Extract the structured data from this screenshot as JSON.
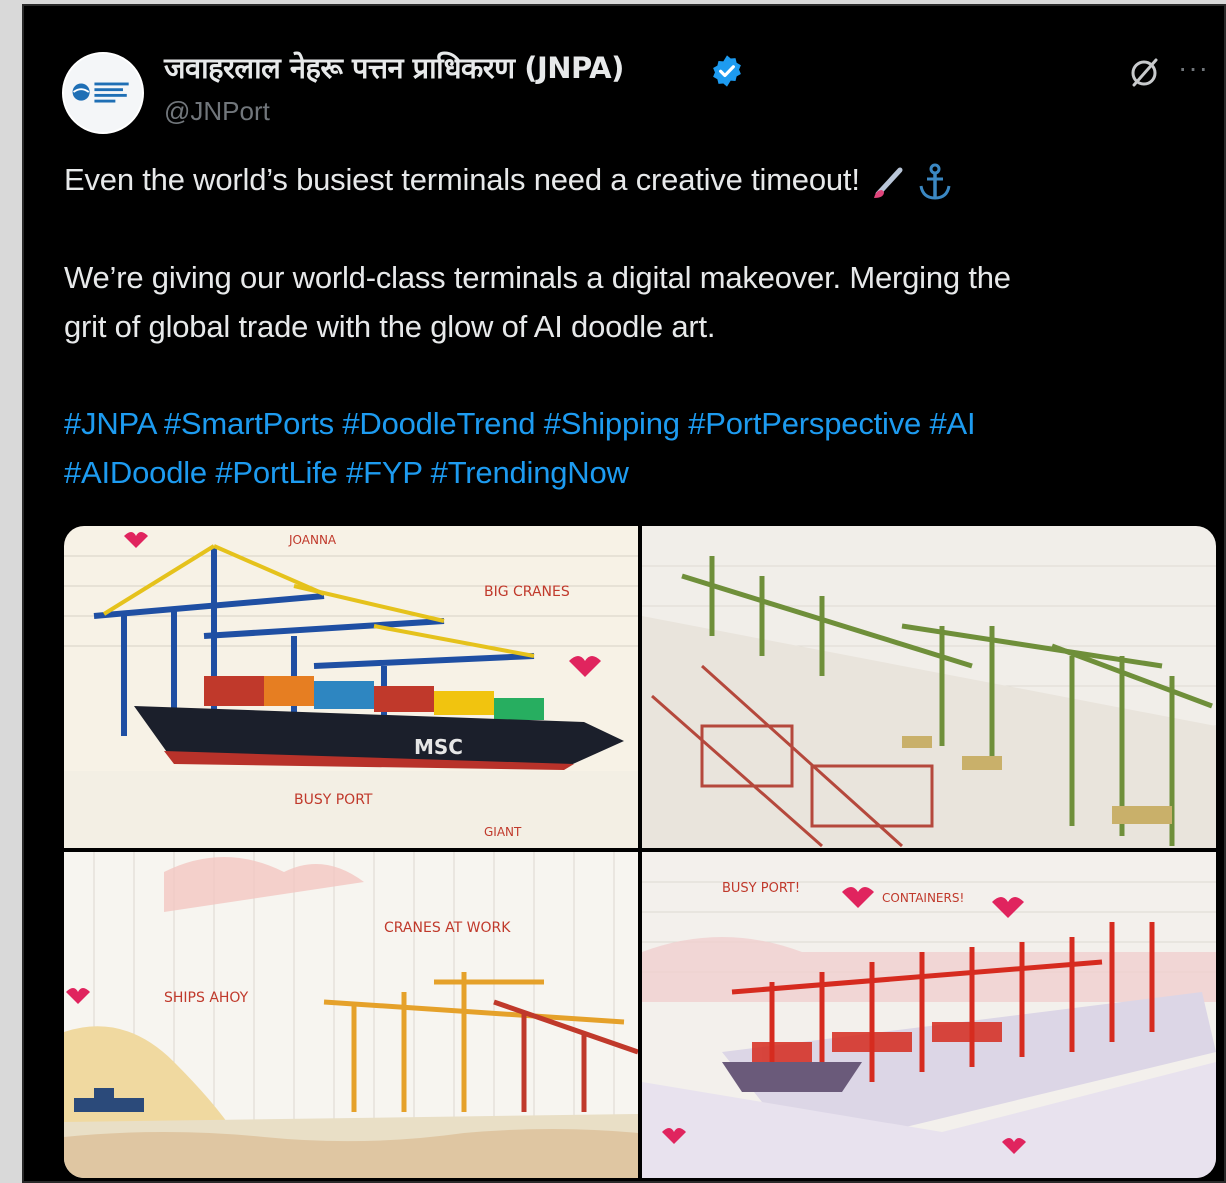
{
  "account": {
    "display_name": "जवाहरलाल नेहरू पत्तन प्राधिकरण (JNPA)",
    "handle": "@JNPort",
    "verified": true,
    "avatar_icon": "jnpa-logo",
    "accent_color": "#1d9bf0"
  },
  "post": {
    "line1": "Even the world’s busiest terminals need a creative timeout!",
    "line1_emojis": [
      "paintbrush-emoji",
      "anchor-emoji"
    ],
    "line2": "We’re giving our world-class terminals a digital makeover. Merging the",
    "line3": "grit of global trade with the glow of AI doodle art.",
    "hashtags_line1": "#JNPA #SmartPorts #DoodleTrend #Shipping #PortPerspective #AI",
    "hashtags_line2": "#AIDoodle #PortLife #FYP #TrendingNow"
  },
  "media": {
    "images": [
      {
        "name": "doodle-container-ship-msc",
        "labels": [
          "JOANNA",
          "BIG CRANES",
          "MSC",
          "BUSY PORT",
          "GIANT"
        ]
      },
      {
        "name": "doodle-green-cranes-terminal",
        "labels": []
      },
      {
        "name": "doodle-cranes-at-work",
        "labels": [
          "CRANES AT WORK",
          "SHIPS AHOY"
        ]
      },
      {
        "name": "doodle-red-cranes-port",
        "labels": [
          "BUSY PORT!",
          "CONTAINERS!"
        ]
      }
    ]
  },
  "icons": {
    "grok": "grok-icon",
    "more": "more-options-icon"
  }
}
